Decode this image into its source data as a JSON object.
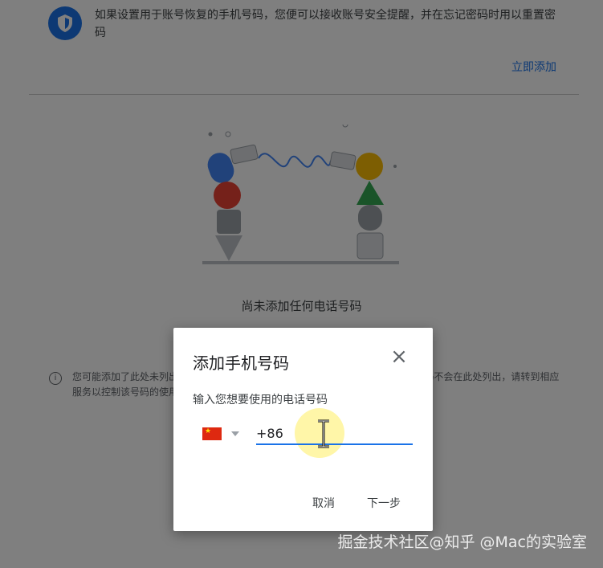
{
  "background": {
    "info_text": "如果设置用于账号恢复的手机号码，您便可以接收账号安全提醒，并在忘记密码时用以重置密码",
    "add_link": "立即添加",
    "empty_text": "尚未添加任何电话号码",
    "note_text": "您可能添加了此处未列出的号码。如果您通过其他Google服务添加了号码，这些号码不会在此处列出，请转到相应服务以控制该号码的使用方式"
  },
  "dialog": {
    "title": "添加手机号码",
    "subtitle": "输入您想要使用的电话号码",
    "phone_value": "+86",
    "cancel_label": "取消",
    "next_label": "下一步",
    "country_icon": "china-flag-icon"
  },
  "watermark": "掘金技术社区@知乎 @Mac的实验室",
  "colors": {
    "accent": "#1a73e8",
    "scrim": "rgba(0,0,0,0.5)",
    "highlight": "#fff06e"
  }
}
